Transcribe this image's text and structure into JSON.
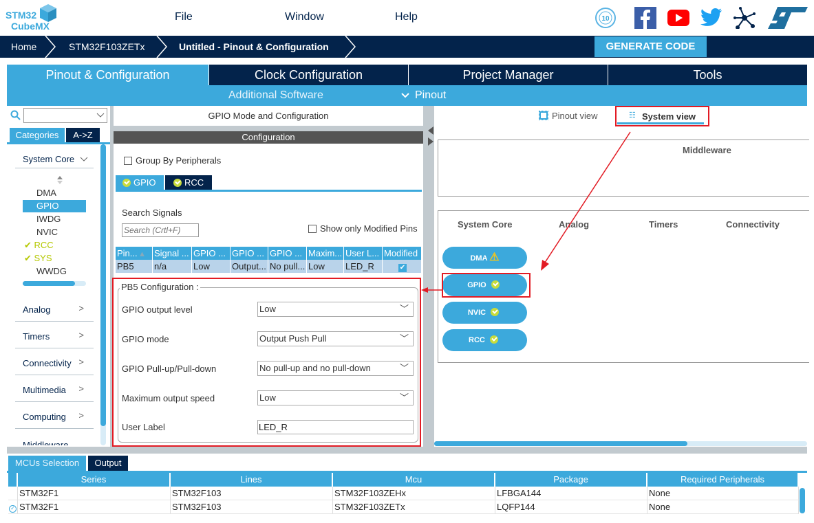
{
  "app": {
    "logo_line1": "STM32",
    "logo_line2": "CubeMX"
  },
  "menu": [
    {
      "label": "File"
    },
    {
      "label": "Window"
    },
    {
      "label": "Help"
    }
  ],
  "header_icons": [
    "anniversary-10-years-icon",
    "facebook-icon",
    "youtube-icon",
    "twitter-icon",
    "network-icon",
    "st-logo-icon"
  ],
  "breadcrumb": [
    {
      "label": "Home"
    },
    {
      "label": "STM32F103ZETx"
    },
    {
      "label": "Untitled - Pinout & Configuration"
    }
  ],
  "generate_code": "GENERATE CODE",
  "main_tabs": [
    {
      "label": "Pinout & Configuration",
      "active": true
    },
    {
      "label": "Clock Configuration"
    },
    {
      "label": "Project Manager"
    },
    {
      "label": "Tools"
    }
  ],
  "subbar": {
    "additional_software": "Additional Software",
    "pinout": "Pinout"
  },
  "sidebar": {
    "search_value": "",
    "tabs": [
      {
        "label": "Categories",
        "active": true
      },
      {
        "label": "A->Z"
      }
    ],
    "system_core": "System Core",
    "items": [
      {
        "label": "DMA",
        "checked": false
      },
      {
        "label": "GPIO",
        "selected": true
      },
      {
        "label": "IWDG"
      },
      {
        "label": "NVIC"
      },
      {
        "label": "RCC",
        "checked": true
      },
      {
        "label": "SYS",
        "checked": true
      },
      {
        "label": "WWDG"
      }
    ],
    "categories": [
      {
        "label": "Analog"
      },
      {
        "label": "Timers"
      },
      {
        "label": "Connectivity"
      },
      {
        "label": "Multimedia"
      },
      {
        "label": "Computing"
      },
      {
        "label": "Middleware"
      }
    ]
  },
  "gpio_panel": {
    "title": "GPIO Mode and Configuration",
    "config_title": "Configuration",
    "group_by": "Group By Peripherals",
    "tabs": [
      {
        "label": "GPIO"
      },
      {
        "label": "RCC"
      }
    ],
    "search_label": "Search Signals",
    "search_placeholder": "Search (Crtl+F)",
    "show_modified": "Show only Modified Pins",
    "columns": [
      "Pin...",
      "Signal ...",
      "GPIO ...",
      "GPIO ...",
      "GPIO ...",
      "Maxim...",
      "User L...",
      "Modified"
    ],
    "rows": [
      [
        "PB5",
        "n/a",
        "Low",
        "Output...",
        "No pull...",
        "Low",
        "LED_R",
        ""
      ]
    ],
    "row_modified": true,
    "pin_config_title": "PB5 Configuration :",
    "fields": [
      {
        "label": "GPIO output level",
        "value": "Low"
      },
      {
        "label": "GPIO mode",
        "value": "Output Push Pull"
      },
      {
        "label": "GPIO Pull-up/Pull-down",
        "value": "No pull-up and no pull-down"
      },
      {
        "label": "Maximum output speed",
        "value": "Low"
      }
    ],
    "user_label": {
      "label": "User Label",
      "value": "LED_R"
    }
  },
  "right_panel": {
    "pinout_view": "Pinout view",
    "system_view": "System view",
    "middleware": "Middleware",
    "categories": [
      "System Core",
      "Analog",
      "Timers",
      "Connectivity"
    ],
    "components": [
      {
        "label": "DMA",
        "status": "warning"
      },
      {
        "label": "GPIO",
        "status": "ok"
      },
      {
        "label": "NVIC",
        "status": "ok"
      },
      {
        "label": "RCC",
        "status": "ok"
      }
    ]
  },
  "bottom": {
    "tabs": [
      {
        "label": "MCUs Selection",
        "active": true
      },
      {
        "label": "Output"
      }
    ],
    "columns": [
      "Series",
      "Lines",
      "Mcu",
      "Package",
      "Required Peripherals"
    ],
    "rows": [
      {
        "cells": [
          "STM32F1",
          "STM32F103",
          "STM32F103ZEHx",
          "LFBGA144",
          "None"
        ],
        "selected": false
      },
      {
        "cells": [
          "STM32F1",
          "STM32F103",
          "STM32F103ZETx",
          "LQFP144",
          "None"
        ],
        "selected": true
      }
    ]
  },
  "colors": {
    "navy": "#03234b",
    "accent": "#3ca9dc",
    "highlight": "#e21b24",
    "check": "#c8dc3c"
  }
}
